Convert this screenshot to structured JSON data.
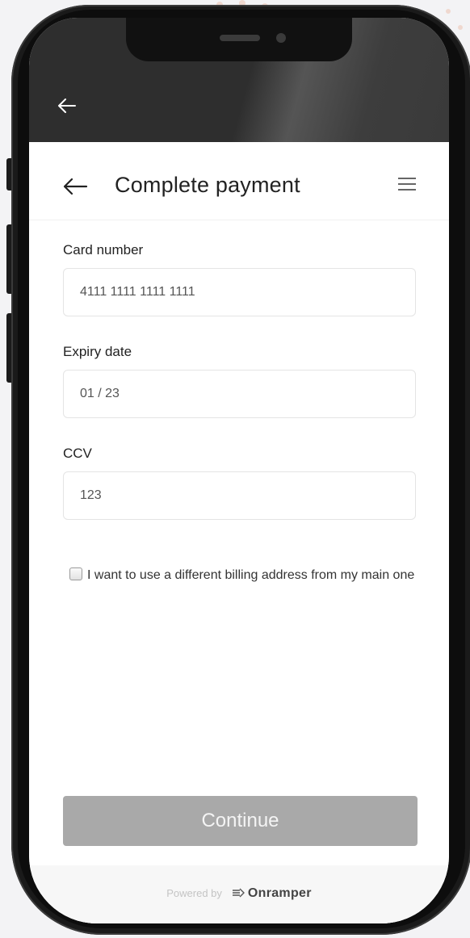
{
  "icons": {
    "wrapper_back": "arrow-left-icon",
    "back": "arrow-left-icon",
    "menu": "hamburger-menu-icon",
    "brand": "onramper-logo-icon"
  },
  "header": {
    "title": "Complete payment"
  },
  "form": {
    "card_number": {
      "label": "Card number",
      "value": "4111 1111 1111 1111"
    },
    "expiry": {
      "label": "Expiry date",
      "value": "01 / 23"
    },
    "ccv": {
      "label": "CCV",
      "value": "123"
    },
    "billing_checkbox": {
      "label": "I want to use a different billing address from my main one",
      "checked": false
    }
  },
  "actions": {
    "continue_label": "Continue"
  },
  "footer": {
    "powered_by": "Powered by",
    "brand_name": "Onramper"
  },
  "colors": {
    "status_bar": "#2e2e2e",
    "continue_disabled": "#a9a9a9",
    "footer_bg": "#f7f7f7"
  }
}
